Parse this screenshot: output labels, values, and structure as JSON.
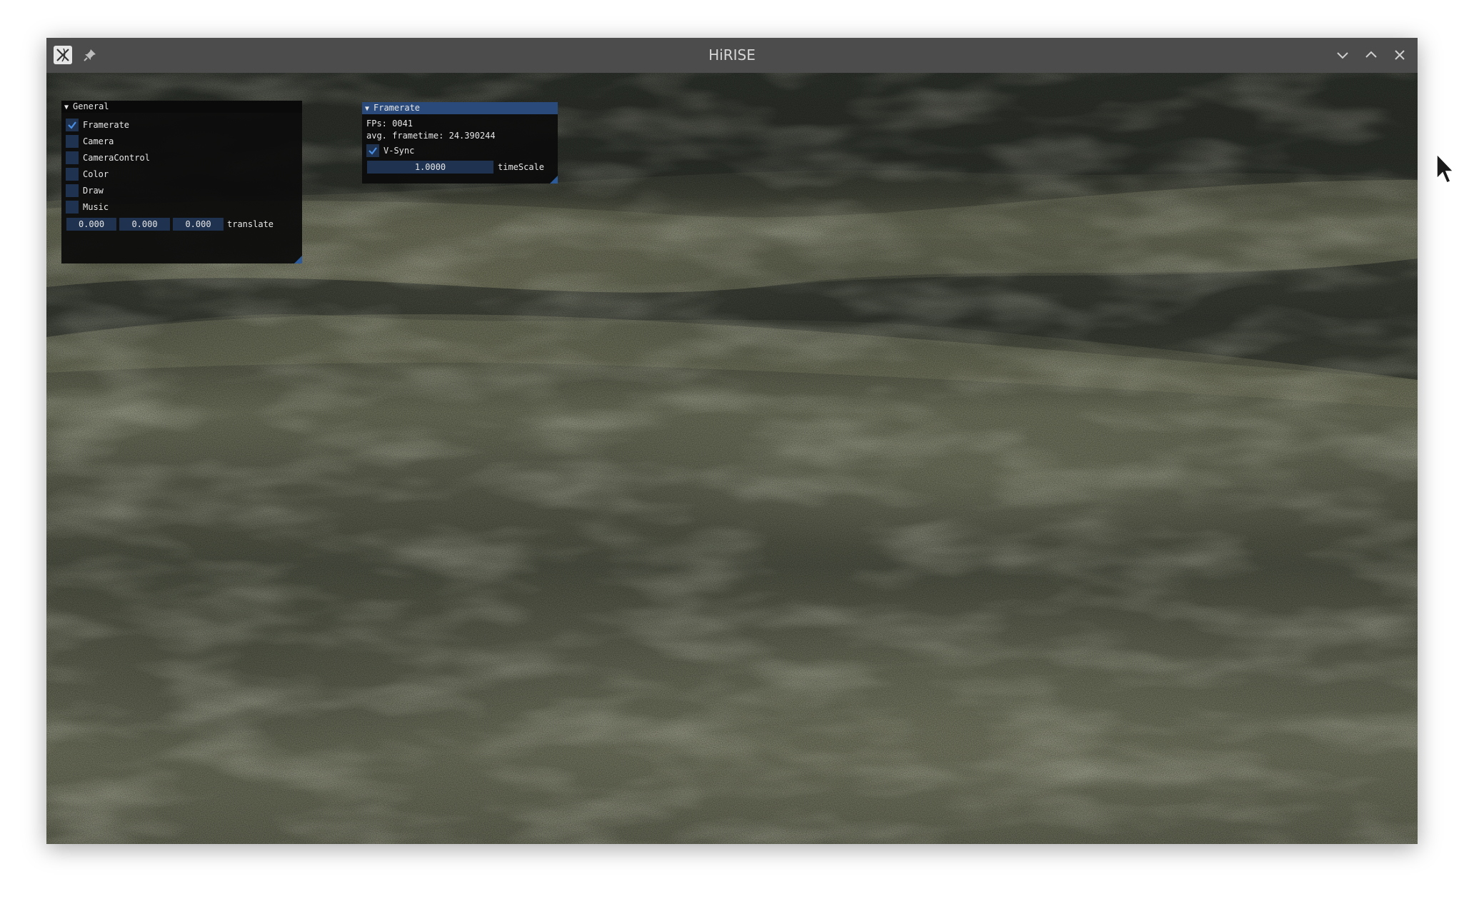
{
  "window": {
    "title": "HiRISE",
    "controls": [
      "minimize",
      "maximize",
      "close"
    ]
  },
  "general_panel": {
    "title": "General",
    "items": [
      {
        "label": "Framerate",
        "checked": true
      },
      {
        "label": "Camera",
        "checked": false
      },
      {
        "label": "CameraControl",
        "checked": false
      },
      {
        "label": "Color",
        "checked": false
      },
      {
        "label": "Draw",
        "checked": false
      },
      {
        "label": "Music",
        "checked": false
      }
    ],
    "translate": {
      "values": [
        "0.000",
        "0.000",
        "0.000"
      ],
      "label": "translate"
    }
  },
  "framerate_panel": {
    "title": "Framerate",
    "fps": "FPs: 0041",
    "frametime": "avg. frametime: 24.390244",
    "vsync": {
      "label": "V-Sync",
      "checked": true
    },
    "timescale": {
      "value": "1.0000",
      "label": "timeScale"
    }
  },
  "colors": {
    "titlebar": "#4c4c4c",
    "panel_active_header": "#294a7a",
    "widget_bg": "#1f3350",
    "check_mark": "#4a8fe7"
  }
}
